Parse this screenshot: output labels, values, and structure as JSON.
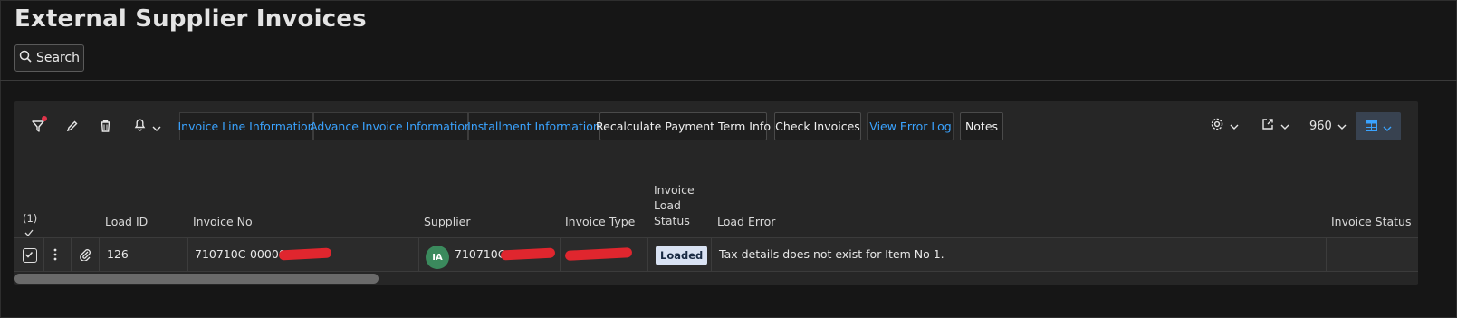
{
  "page": {
    "title": "External Supplier Invoices",
    "search_label": "Search"
  },
  "toolbar": {
    "buttons": [
      "Invoice Line Information",
      "Advance Invoice Information",
      "Installment Information",
      "Recalculate Payment Term Info",
      "Check Invoices",
      "View Error Log",
      "Notes"
    ],
    "row_count": "960"
  },
  "table": {
    "selection_count": "(1)",
    "columns": [
      "Load ID",
      "Invoice No",
      "Supplier",
      "Invoice Type",
      "Invoice",
      "Load",
      "Status",
      "Load Error",
      "Invoice Status"
    ],
    "row": {
      "load_id": "126",
      "invoice_no": "710710C-00000",
      "supplier_initials": "IA",
      "supplier": "710710C",
      "status": "Loaded",
      "load_error": "Tax details does not exist for Item No 1."
    }
  },
  "colors": {
    "link": "#3aa3ff",
    "avatar": "#3b8a5d",
    "redaction": "#e0262e"
  }
}
